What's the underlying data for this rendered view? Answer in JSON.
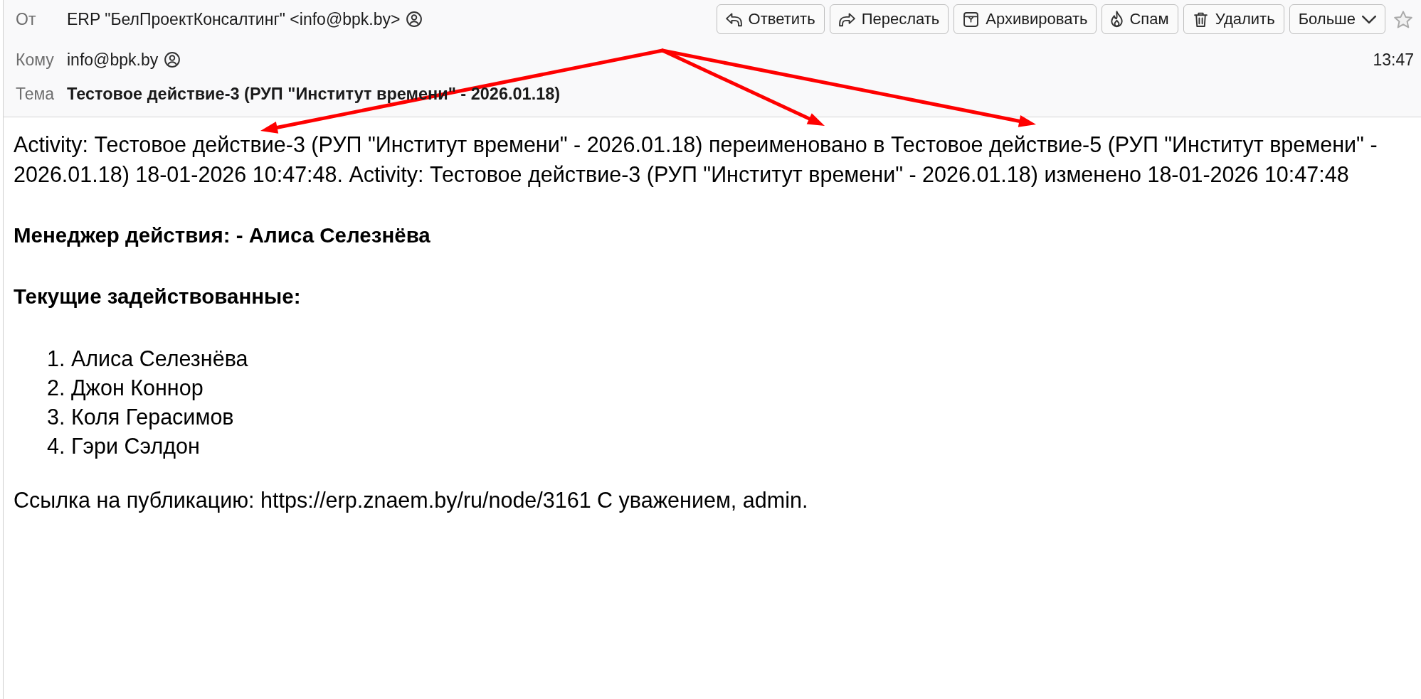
{
  "header": {
    "fields": [
      {
        "label": "От",
        "value": "ERP \"БелПроектКонсалтинг\" <info@bpk.by>",
        "kind": "address"
      },
      {
        "label": "Кому",
        "value": "info@bpk.by",
        "kind": "address"
      },
      {
        "label": "Тема",
        "value": "Тестовое действие-3 (РУП \"Институт времени\" - 2026.01.18)",
        "kind": "subject"
      }
    ],
    "actions": [
      {
        "label": "Ответить",
        "kind": "reply"
      },
      {
        "label": "Переслать",
        "kind": "forward"
      },
      {
        "label": "Архивировать",
        "kind": "archive"
      },
      {
        "label": "Спам",
        "kind": "spam"
      },
      {
        "label": "Удалить",
        "kind": "delete"
      },
      {
        "label": "Больше",
        "kind": "more"
      }
    ],
    "starred": false,
    "time": "13:47"
  },
  "body": {
    "intro": "Activity: Тестовое действие-3 (РУП \"Институт времени\" - 2026.01.18) переименовано в Тестовое действие-5 (РУП \"Институт времени\" - 2026.01.18) 18-01-2026 10:47:48. Activity: Тестовое действие-3 (РУП \"Институт времени\" - 2026.01.18) изменено 18-01-2026 10:47:48",
    "manager": "Менеджер действия: - Алиса Селезнёва",
    "participants_heading": "Текущие задействованные:",
    "participants": [
      "1. Алиса Селезнёва",
      "2. Джон Коннор",
      "3. Коля Герасимов",
      "4. Гэри Сэлдон"
    ],
    "footer": "Ссылка на публикацию: https://erp.znaem.by/ru/node/3161 С уважением, admin."
  },
  "annotations": [
    {
      "kind": "arrow"
    },
    {
      "kind": "arrow"
    },
    {
      "kind": "arrow"
    }
  ]
}
